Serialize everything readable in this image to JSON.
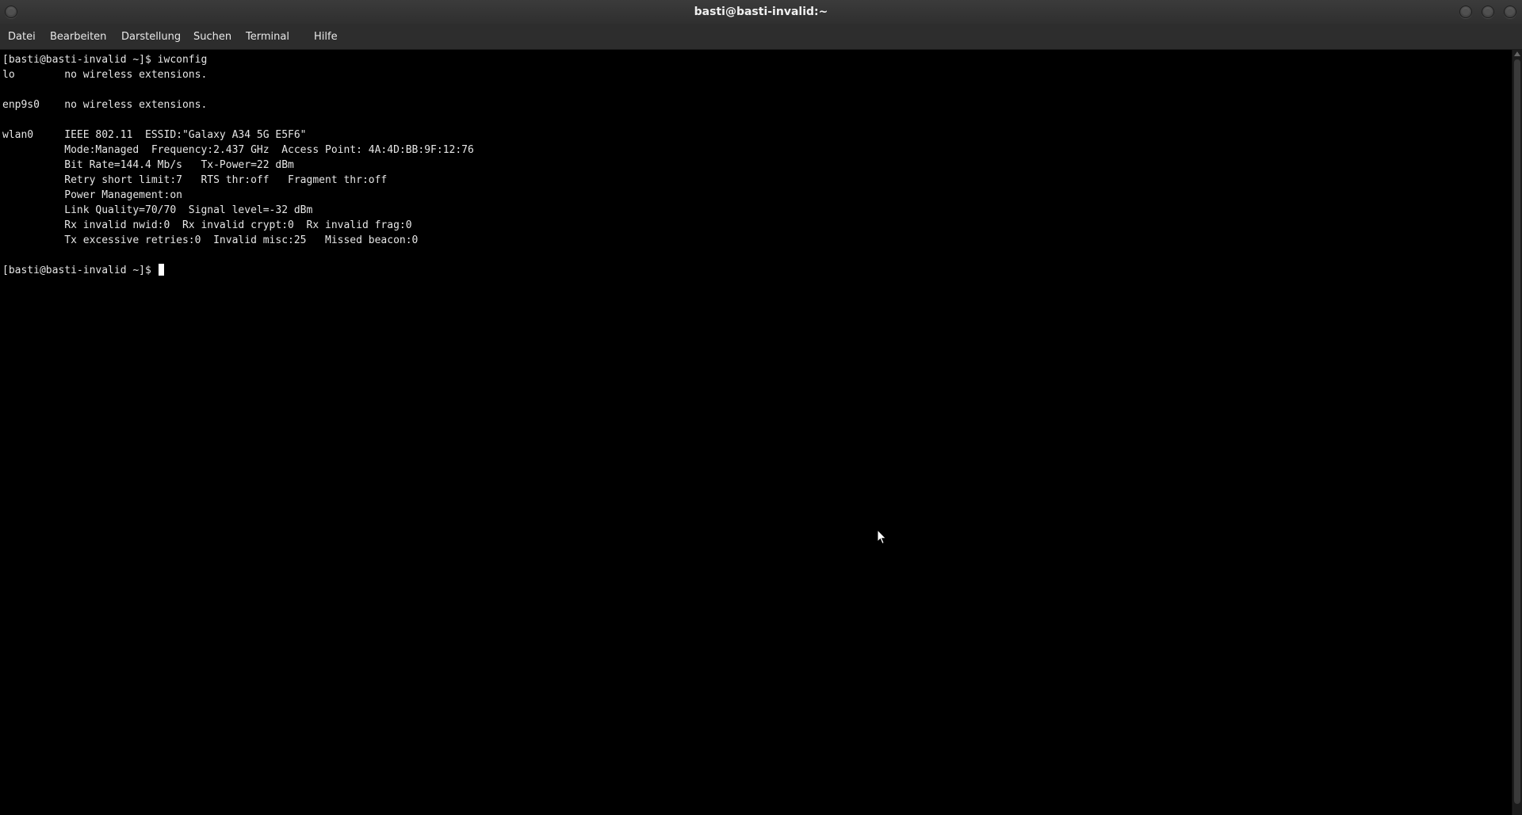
{
  "window": {
    "title": "basti@basti-invalid:~",
    "menu_button": "window-menu",
    "controls": [
      "minimize",
      "maximize",
      "close"
    ]
  },
  "menubar": {
    "items": [
      "Datei",
      "Bearbeiten",
      "Darstellung",
      "Suchen",
      "Terminal",
      "Hilfe"
    ]
  },
  "terminal": {
    "lines": [
      "[basti@basti-invalid ~]$ iwconfig",
      "lo        no wireless extensions.",
      "",
      "enp9s0    no wireless extensions.",
      "",
      "wlan0     IEEE 802.11  ESSID:\"Galaxy A34 5G E5F6\"",
      "          Mode:Managed  Frequency:2.437 GHz  Access Point: 4A:4D:BB:9F:12:76",
      "          Bit Rate=144.4 Mb/s   Tx-Power=22 dBm",
      "          Retry short limit:7   RTS thr:off   Fragment thr:off",
      "          Power Management:on",
      "          Link Quality=70/70  Signal level=-32 dBm",
      "          Rx invalid nwid:0  Rx invalid crypt:0  Rx invalid frag:0",
      "          Tx excessive retries:0  Invalid misc:25   Missed beacon:0",
      "",
      "[basti@basti-invalid ~]$ "
    ]
  },
  "colors": {
    "terminal_bg": "#000000",
    "terminal_fg": "#e6e6e6",
    "chrome_bg": "#2d2d2d",
    "cursor": "#ffffff"
  },
  "icons": {
    "pointer": "mouse-pointer-icon"
  }
}
